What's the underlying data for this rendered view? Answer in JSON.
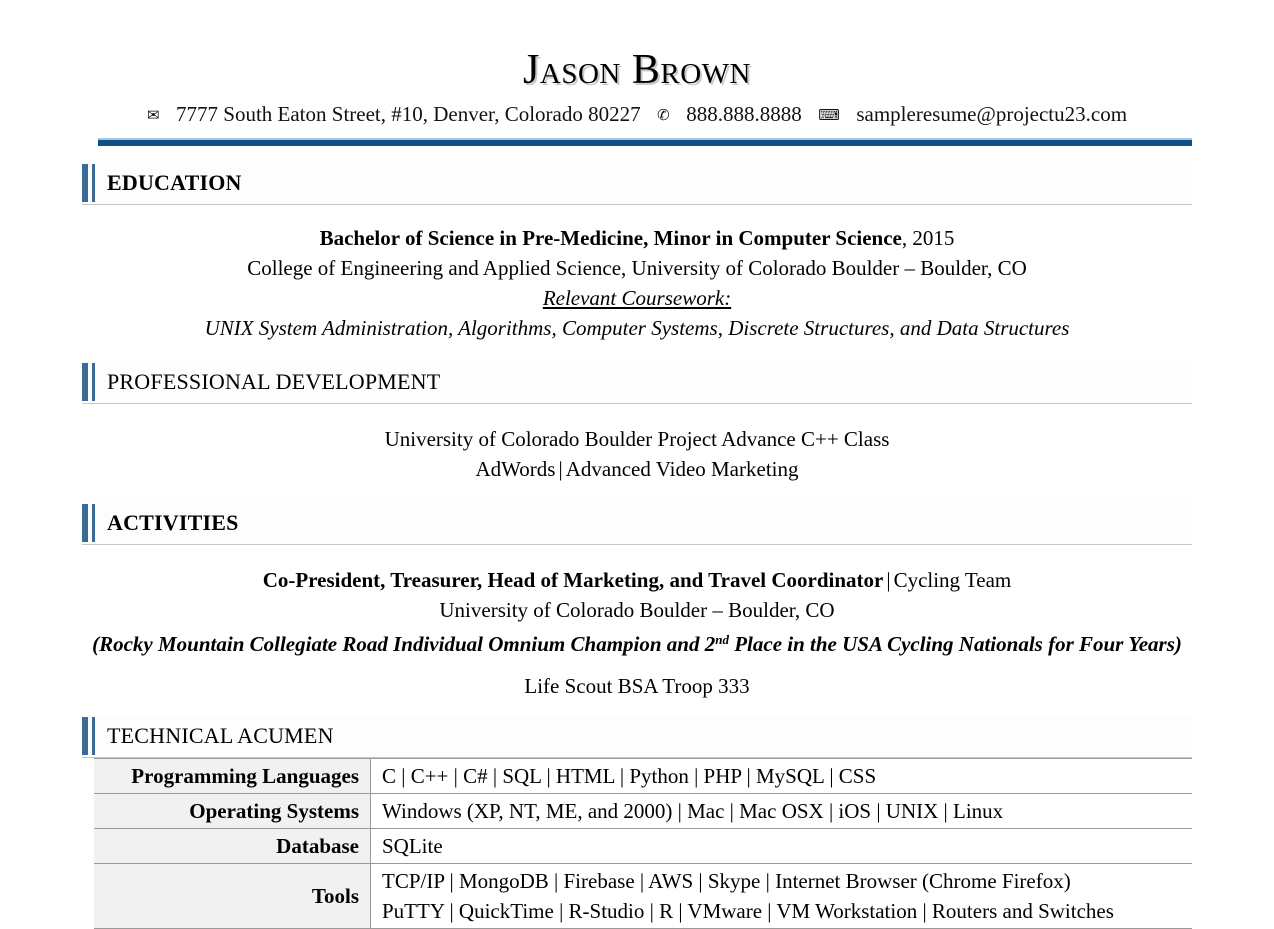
{
  "header": {
    "name": "Jason Brown",
    "mail_icon": "✉",
    "address": "7777 South Eaton Street, #10, Denver, Colorado 80227",
    "phone_icon": "✆",
    "phone": "888.888.8888",
    "email_icon": "⌨",
    "email": "sampleresume@projectu23.com"
  },
  "colors": {
    "rule_blue": "#0d4f86",
    "bar_blue": "#3a6b96",
    "table_key_bg": "#f1f1f1",
    "table_border": "#9a9a9a"
  },
  "sections": {
    "education": {
      "title": "EDUCATION",
      "degree": "Bachelor of Science in Pre-Medicine, Minor in Computer Science",
      "year": ", 2015",
      "school": "College of Engineering and Applied Science, University of Colorado Boulder – Boulder, CO",
      "coursework_label": "Relevant Coursework:",
      "coursework": "UNIX System Administration, Algorithms, Computer Systems, Discrete Structures, and Data Structures"
    },
    "professional_development": {
      "title": "PROFESSIONAL DEVELOPMENT",
      "line1": "University of Colorado Boulder Project Advance C++ Class",
      "line2_a": "AdWords",
      "line2_sep": "|",
      "line2_b": "Advanced Video Marketing"
    },
    "activities": {
      "title": "ACTIVITIES",
      "role": "Co-President, Treasurer, Head of Marketing, and Travel Coordinator",
      "role_sep": "|",
      "org": "Cycling Team",
      "school": "University of Colorado Boulder – Boulder, CO",
      "note_before": "(Rocky Mountain Collegiate Road Individual Omnium Champion and 2",
      "note_sup": "nd",
      "note_after": " Place in the USA Cycling Nationals for Four Years)",
      "scout": "Life Scout BSA Troop 333"
    },
    "technical_acumen": {
      "title": "TECHNICAL ACUMEN",
      "rows": [
        {
          "label": "Programming Languages",
          "lines": [
            "C | C++ | C# | SQL | HTML | Python | PHP | MySQL | CSS"
          ]
        },
        {
          "label": "Operating Systems",
          "lines": [
            "Windows (XP, NT, ME, and 2000) | Mac | Mac OSX | iOS | UNIX | Linux"
          ]
        },
        {
          "label": "Database",
          "lines": [
            "SQLite"
          ]
        },
        {
          "label": "Tools",
          "lines": [
            "TCP/IP | MongoDB | Firebase | AWS | Skype | Internet Browser (Chrome Firefox)",
            "PuTTY | QuickTime | R-Studio | R | VMware | VM Workstation | Routers and Switches"
          ]
        }
      ]
    }
  }
}
